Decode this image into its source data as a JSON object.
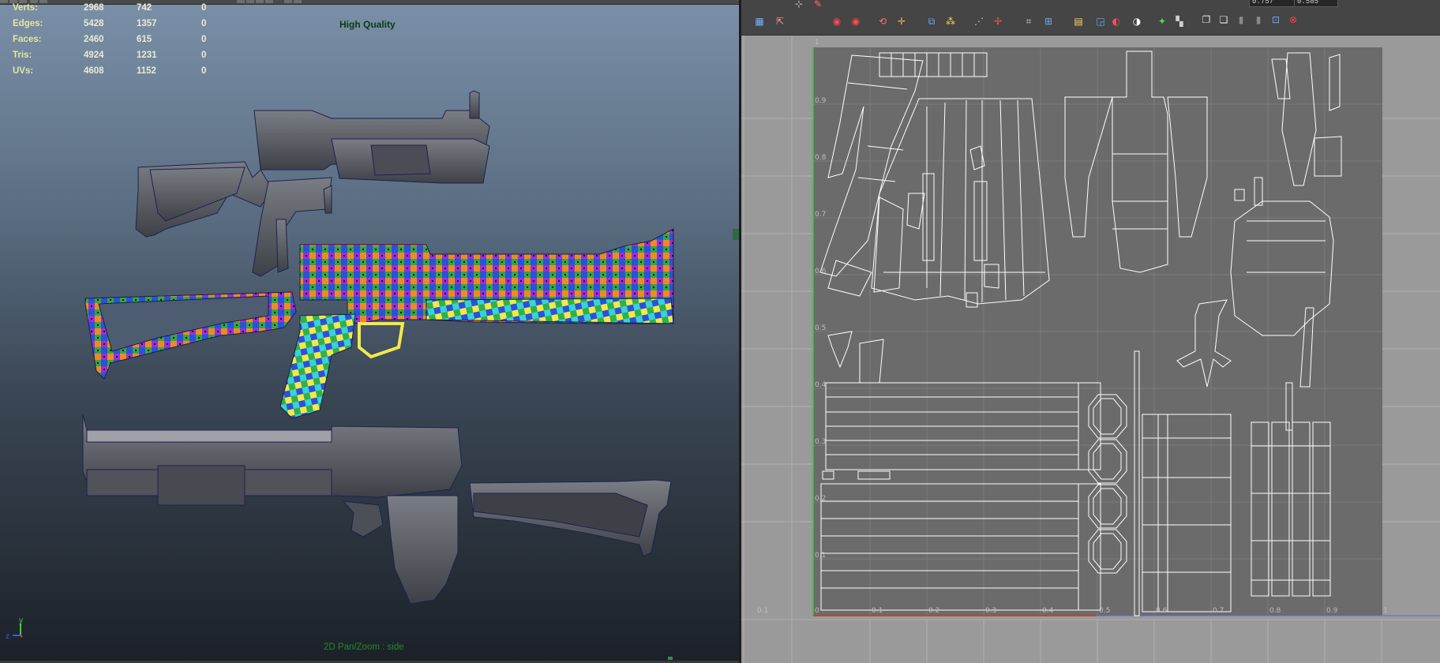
{
  "viewport": {
    "stats": [
      {
        "label": "Verts:",
        "v1": "2968",
        "v2": "742",
        "v3": "0"
      },
      {
        "label": "Edges:",
        "v1": "5428",
        "v2": "1357",
        "v3": "0"
      },
      {
        "label": "Faces:",
        "v1": "2460",
        "v2": "615",
        "v3": "0"
      },
      {
        "label": "Tris:",
        "v1": "4924",
        "v2": "1231",
        "v3": "0"
      },
      {
        "label": "UVs:",
        "v1": "4608",
        "v2": "1152",
        "v3": "0"
      }
    ],
    "quality_label": "High Quality",
    "camera_label": "2D Pan/Zoom : side",
    "axis_y": "y",
    "axis_z": "z"
  },
  "uv_editor": {
    "top_fields": [
      "0.757",
      "0.585"
    ],
    "toolbar_icons": [
      "grid-display-icon",
      "select-tool-icon",
      "move-uv-icon",
      "lattice-icon",
      "snapshot-icon",
      "uv-shell-icon",
      "flip-u-icon",
      "flip-v-icon",
      "rotate-ccw-icon",
      "rotate-cw-icon",
      "cut-uv-icon",
      "sew-uv-icon",
      "unfold-icon",
      "layout-uv-icon",
      "align-icon",
      "grid-uv-icon",
      "checker-icon",
      "texture-filter-icon",
      "dim-image-icon",
      "isolate-icon",
      "copy-uv-icon",
      "paste-uv-icon",
      "paste-u-icon",
      "paste-v-icon",
      "delete-icon"
    ],
    "axis_labels": {
      "v_top": "1",
      "v_ticks": [
        "0.9",
        "0.8",
        "0.7",
        "0.6",
        "0.5",
        "0.4",
        "0.3",
        "0.2",
        "0.1"
      ],
      "u_ticks": [
        "0.1",
        "0",
        "0.1",
        "0.2",
        "0.3",
        "0.4",
        "0.5",
        "0.6",
        "0.7",
        "0.8",
        "0.9",
        "1"
      ]
    }
  },
  "colors": {
    "stat_text": "#e3e8a0",
    "quality_text": "#0a3a16",
    "camera_text": "#1f8a2a",
    "uv_frame": "#6b6b6b",
    "uv_lines": "#ffffff",
    "axis_u": "#c8382e",
    "axis_v": "#3cc23c"
  }
}
